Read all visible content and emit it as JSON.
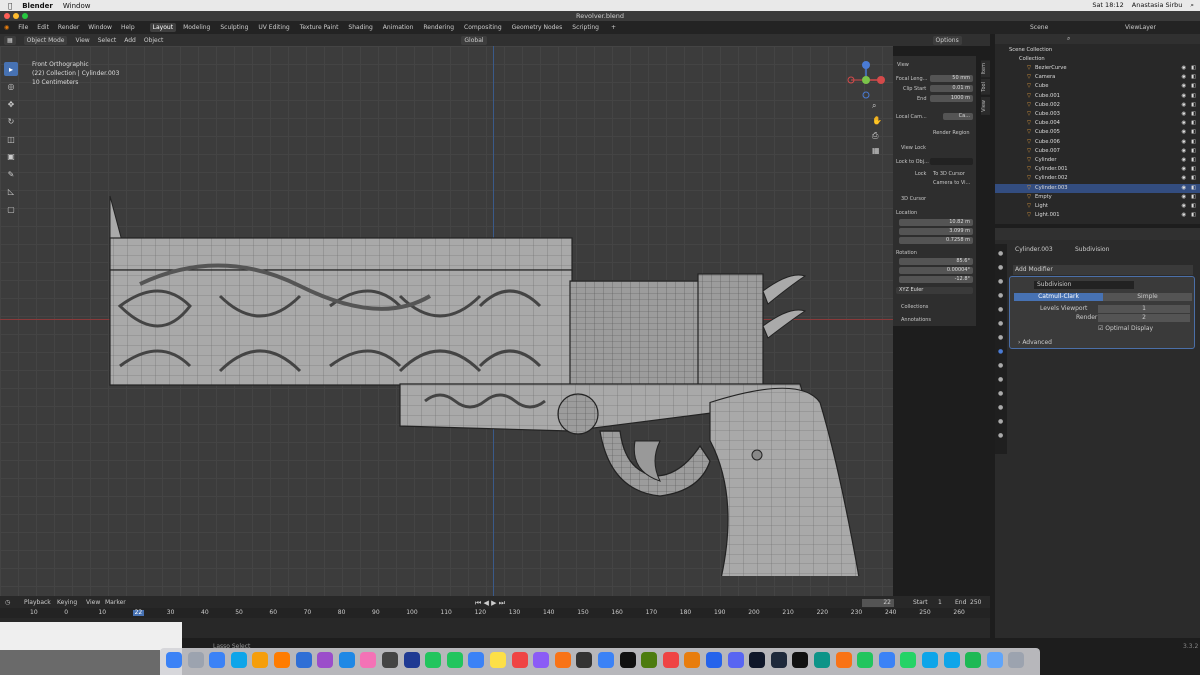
{
  "menubar": {
    "app": "Blender",
    "window": "Window",
    "clock": "Sat 18:12",
    "user": "Anastasia Sirbu"
  },
  "window": {
    "title": "Revolver.blend"
  },
  "bmenu": {
    "items": [
      "File",
      "Edit",
      "Render",
      "Window",
      "Help"
    ],
    "workspaces": [
      "Layout",
      "Modeling",
      "Sculpting",
      "UV Editing",
      "Texture Paint",
      "Shading",
      "Animation",
      "Rendering",
      "Compositing",
      "Geometry Nodes",
      "Scripting"
    ],
    "active": "Layout",
    "scene": "Scene",
    "viewlayer": "ViewLayer"
  },
  "header": {
    "mode": "Object Mode",
    "view": "View",
    "select": "Select",
    "add": "Add",
    "object": "Object",
    "orientation": "Global",
    "options": "Options"
  },
  "overlay": {
    "line1": "Front Orthographic",
    "line2": "(22) Collection | Cylinder.003",
    "line3": "10 Centimeters"
  },
  "npanel": {
    "view_section": "View",
    "focal_label": "Focal Leng...",
    "focal_value": "50 mm",
    "clip_start_label": "Clip Start",
    "clip_start_value": "0.01 m",
    "end_label": "End",
    "end_value": "1000 m",
    "local_camera_label": "Local Cam...",
    "local_camera_value": "Ca...",
    "render_region": "Render Region",
    "view_lock": "View Lock",
    "lock_to_obj": "Lock to Obj...",
    "lock_label": "Lock",
    "to_3d_cursor": "To 3D Cursor",
    "camera_to_view": "Camera to Vi...",
    "cursor_section": "3D Cursor",
    "location": "Location",
    "x_label": "X",
    "loc_x": "10.82 m",
    "y_label": "Y",
    "loc_y": "3.099 m",
    "z_label": "Z",
    "loc_z": "0.7258 m",
    "rotation": "Rotation",
    "rot_x": "85.6°",
    "rot_y": "0.00004°",
    "rot_z": "-12.8°",
    "euler": "XYZ Euler",
    "collections": "Collections",
    "annotations": "Annotations",
    "tabs": [
      "Item",
      "Tool",
      "View"
    ]
  },
  "outliner": {
    "title": "Scene Collection",
    "collection": "Collection",
    "items": [
      "BezierCurve",
      "Camera",
      "Cube",
      "Cube.001",
      "Cube.002",
      "Cube.003",
      "Cube.004",
      "Cube.005",
      "Cube.006",
      "Cube.007",
      "Cylinder",
      "Cylinder.001",
      "Cylinder.002",
      "Cylinder.003",
      "Empty",
      "Light",
      "Light.001"
    ],
    "selected": "Cylinder.003"
  },
  "properties": {
    "breadcrumb_object": "Cylinder.003",
    "breadcrumb_modifier": "Subdivision",
    "add_modifier": "Add Modifier",
    "modifier_name": "Subdivision",
    "catmull": "Catmull-Clark",
    "simple": "Simple",
    "levels_viewport_label": "Levels Viewport",
    "levels_viewport": "1",
    "render_label": "Render",
    "render_value": "2",
    "optimal_display": "Optimal Display",
    "advanced": "Advanced"
  },
  "timeline": {
    "playback": "Playback",
    "keying": "Keying",
    "view": "View",
    "marker": "Marker",
    "current_frame": "22",
    "start_label": "Start",
    "start_value": "1",
    "end_label": "End",
    "end_value": "250",
    "ticks": [
      "10",
      "0",
      "10",
      "22",
      "30",
      "40",
      "50",
      "60",
      "70",
      "80",
      "90",
      "100",
      "110",
      "120",
      "130",
      "140",
      "150",
      "160",
      "170",
      "180",
      "190",
      "200",
      "210",
      "220",
      "230",
      "240",
      "250",
      "260"
    ],
    "status": "Lasso Select",
    "version": "3.3.2"
  },
  "dock": {
    "apps": [
      "Finder",
      "Launchpad",
      "Preview",
      "Safari",
      "Chrome",
      "Illustrator",
      "Photoshop",
      "Animate",
      "Muse",
      "Photos",
      "Final Cut",
      "Cinema",
      "Maps",
      "Messages",
      "Mail",
      "Notes",
      "Calendar",
      "Slack",
      "Books",
      "Terminal",
      "App Store",
      "Unity",
      "Minecraft",
      "Music",
      "Blender",
      "Zoom",
      "Discord",
      "Affinity",
      "Steam",
      "bi",
      "Maya",
      "Pages",
      "Numbers",
      "Keynote",
      "WhatsApp",
      "Skype",
      "Telegram",
      "Spotify",
      "Folder",
      "Trash"
    ]
  },
  "colors": {
    "accent": "#4772b3",
    "selected_row": "#334d80",
    "viewport": "#3c3c3c"
  }
}
